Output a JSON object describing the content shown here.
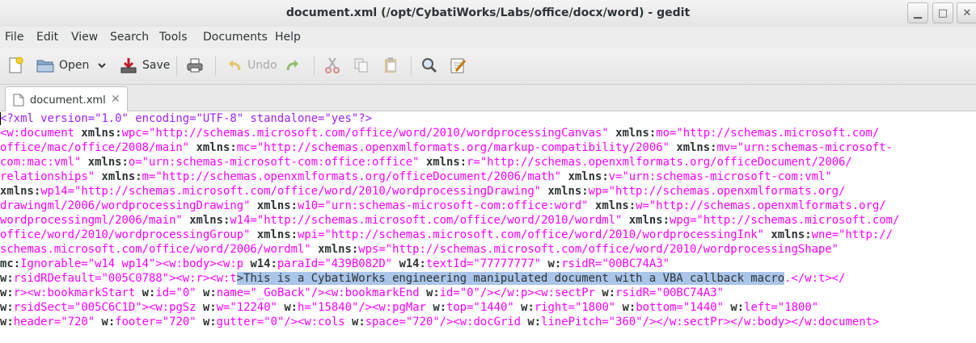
{
  "window": {
    "title": "document.xml (/opt/CybatiWorks/Labs/office/docx/word) - gedit"
  },
  "menubar": [
    "File",
    "Edit",
    "View",
    "Search",
    "Tools",
    "Documents",
    "Help"
  ],
  "toolbar": {
    "open_label": "Open",
    "save_label": "Save",
    "undo_label": "Undo"
  },
  "tab": {
    "name": "document.xml"
  },
  "editor": {
    "lines": [
      [
        [
          "<?xml version=\"1.0\" encoding=\"UTF-8\" standalone=\"yes\"?>",
          0
        ]
      ],
      [
        [
          "<w:",
          1
        ],
        [
          "document",
          1
        ],
        [
          " ",
          3
        ],
        [
          "xmlns:",
          2
        ],
        [
          "wpc=\"http://schemas.microsoft.com/office/word/2010/wordprocessingCanvas\"",
          1
        ],
        [
          " ",
          3
        ],
        [
          "xmlns:",
          2
        ],
        [
          "mo=\"http://schemas.microsoft.com/",
          1
        ]
      ],
      [
        [
          "office/mac/office/2008/main\"",
          1
        ],
        [
          " ",
          3
        ],
        [
          "xmlns:",
          2
        ],
        [
          "mc=\"http://schemas.openxmlformats.org/markup-compatibility/2006\"",
          1
        ],
        [
          " ",
          3
        ],
        [
          "xmlns:",
          2
        ],
        [
          "mv=\"urn:schemas-microsoft-",
          1
        ]
      ],
      [
        [
          "com:mac:vml\"",
          1
        ],
        [
          " ",
          3
        ],
        [
          "xmlns:",
          2
        ],
        [
          "o=\"urn:schemas-microsoft-com:office:office\"",
          1
        ],
        [
          " ",
          3
        ],
        [
          "xmlns:",
          2
        ],
        [
          "r=\"http://schemas.openxmlformats.org/officeDocument/2006/",
          1
        ]
      ],
      [
        [
          "relationships\"",
          1
        ],
        [
          " ",
          3
        ],
        [
          "xmlns:",
          2
        ],
        [
          "m=\"http://schemas.openxmlformats.org/officeDocument/2006/math\"",
          1
        ],
        [
          " ",
          3
        ],
        [
          "xmlns:",
          2
        ],
        [
          "v=\"urn:schemas-microsoft-com:vml\"",
          1
        ]
      ],
      [
        [
          "xmlns:",
          2
        ],
        [
          "wp14=\"http://schemas.microsoft.com/office/word/2010/wordprocessingDrawing\"",
          1
        ],
        [
          " ",
          3
        ],
        [
          "xmlns:",
          2
        ],
        [
          "wp=\"http://schemas.openxmlformats.org/",
          1
        ]
      ],
      [
        [
          "drawingml/2006/wordprocessingDrawing\"",
          1
        ],
        [
          " ",
          3
        ],
        [
          "xmlns:",
          2
        ],
        [
          "w10=\"urn:schemas-microsoft-com:office:word\"",
          1
        ],
        [
          " ",
          3
        ],
        [
          "xmlns:",
          2
        ],
        [
          "w=\"http://schemas.openxmlformats.org/",
          1
        ]
      ],
      [
        [
          "wordprocessingml/2006/main\"",
          1
        ],
        [
          " ",
          3
        ],
        [
          "xmlns:",
          2
        ],
        [
          "w14=\"http://schemas.microsoft.com/office/word/2010/wordml\"",
          1
        ],
        [
          " ",
          3
        ],
        [
          "xmlns:",
          2
        ],
        [
          "wpg=\"http://schemas.microsoft.com/",
          1
        ]
      ],
      [
        [
          "office/word/2010/wordprocessingGroup\"",
          1
        ],
        [
          " ",
          3
        ],
        [
          "xmlns:",
          2
        ],
        [
          "wpi=\"http://schemas.microsoft.com/office/word/2010/wordprocessingInk\"",
          1
        ],
        [
          " ",
          3
        ],
        [
          "xmlns:",
          2
        ],
        [
          "wne=\"http://",
          1
        ]
      ],
      [
        [
          "schemas.microsoft.com/office/word/2006/wordml\"",
          1
        ],
        [
          " ",
          3
        ],
        [
          "xmlns:",
          2
        ],
        [
          "wps=\"http://schemas.microsoft.com/office/word/2010/wordprocessingShape\"",
          1
        ]
      ],
      [
        [
          "mc:",
          2
        ],
        [
          "Ignorable=\"w14 wp14\"><w:body><w:p",
          1
        ],
        [
          " ",
          3
        ],
        [
          "w14:",
          2
        ],
        [
          "paraId=\"439B082D\"",
          1
        ],
        [
          " ",
          3
        ],
        [
          "w14:",
          2
        ],
        [
          "textId=\"77777777\"",
          1
        ],
        [
          " ",
          3
        ],
        [
          "w:",
          2
        ],
        [
          "rsidR=\"00BC74A3\"",
          1
        ]
      ],
      [
        [
          "w:",
          2
        ],
        [
          "rsidRDefault=\"005C0788\"><w:r><w:t",
          1
        ],
        [
          ">This is a CybatiWorks engineering manipulated document with a VBA callback macro",
          4
        ],
        [
          ".</w:t></",
          1
        ]
      ],
      [
        [
          "w:",
          2
        ],
        [
          "r><w:bookmarkStart",
          1
        ],
        [
          " ",
          3
        ],
        [
          "w:",
          2
        ],
        [
          "id=\"0\"",
          1
        ],
        [
          " ",
          3
        ],
        [
          "w:",
          2
        ],
        [
          "name=\"_GoBack\"/><w:bookmarkEnd",
          1
        ],
        [
          " ",
          3
        ],
        [
          "w:",
          2
        ],
        [
          "id=\"0\"/></w:p><w:sectPr",
          1
        ],
        [
          " ",
          3
        ],
        [
          "w:",
          2
        ],
        [
          "rsidR=\"00BC74A3\"",
          1
        ]
      ],
      [
        [
          "w:",
          2
        ],
        [
          "rsidSect=\"005C6C1D\"><w:pgSz",
          1
        ],
        [
          " ",
          3
        ],
        [
          "w:",
          2
        ],
        [
          "w=\"12240\"",
          1
        ],
        [
          " ",
          3
        ],
        [
          "w:",
          2
        ],
        [
          "h=\"15840\"/><w:pgMar",
          1
        ],
        [
          " ",
          3
        ],
        [
          "w:",
          2
        ],
        [
          "top=\"1440\"",
          1
        ],
        [
          " ",
          3
        ],
        [
          "w:",
          2
        ],
        [
          "right=\"1800\"",
          1
        ],
        [
          " ",
          3
        ],
        [
          "w:",
          2
        ],
        [
          "bottom=\"1440\"",
          1
        ],
        [
          " ",
          3
        ],
        [
          "w:",
          2
        ],
        [
          "left=\"1800\"",
          1
        ]
      ],
      [
        [
          "w:",
          2
        ],
        [
          "header=\"720\"",
          1
        ],
        [
          " ",
          3
        ],
        [
          "w:",
          2
        ],
        [
          "footer=\"720\"",
          1
        ],
        [
          " ",
          3
        ],
        [
          "w:",
          2
        ],
        [
          "gutter=\"0\"/><w:cols",
          1
        ],
        [
          " ",
          3
        ],
        [
          "w:",
          2
        ],
        [
          "space=\"720\"/><w:docGrid",
          1
        ],
        [
          " ",
          3
        ],
        [
          "w:",
          2
        ],
        [
          "linePitch=\"360\"/></w:sectPr></w:body></w:document>",
          1
        ]
      ]
    ]
  }
}
